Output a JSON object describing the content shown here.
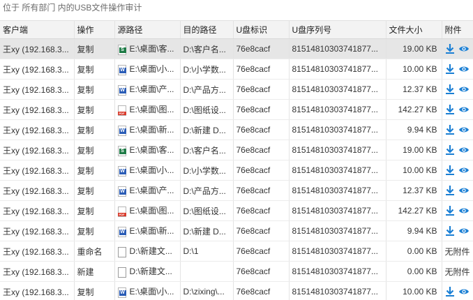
{
  "breadcrumb": "位于 所有部门 内的USB文件操作审计",
  "columns": [
    "客户端",
    "操作",
    "源路径",
    "目的路径",
    "U盘标识",
    "U盘序列号",
    "文件大小",
    "附件"
  ],
  "rows": [
    {
      "client": "王xy (192.168.3...",
      "op": "复制",
      "icon": "excel",
      "src": "E:\\桌面\\客...",
      "dst": "D:\\客户名...",
      "uid": "76e8cacf",
      "serial": "81514810303741877...",
      "size": "19.00 KB",
      "attach": "icons",
      "selected": true
    },
    {
      "client": "王xy (192.168.3...",
      "op": "复制",
      "icon": "word",
      "src": "E:\\桌面\\小...",
      "dst": "D:\\小学数...",
      "uid": "76e8cacf",
      "serial": "81514810303741877...",
      "size": "10.00 KB",
      "attach": "icons"
    },
    {
      "client": "王xy (192.168.3...",
      "op": "复制",
      "icon": "word",
      "src": "E:\\桌面\\产...",
      "dst": "D:\\产品方...",
      "uid": "76e8cacf",
      "serial": "81514810303741877...",
      "size": "12.37 KB",
      "attach": "icons"
    },
    {
      "client": "王xy (192.168.3...",
      "op": "复制",
      "icon": "pdf",
      "src": "E:\\桌面\\图...",
      "dst": "D:\\图纸设...",
      "uid": "76e8cacf",
      "serial": "81514810303741877...",
      "size": "142.27 KB",
      "attach": "icons"
    },
    {
      "client": "王xy (192.168.3...",
      "op": "复制",
      "icon": "word",
      "src": "E:\\桌面\\新...",
      "dst": "D:\\新建 D...",
      "uid": "76e8cacf",
      "serial": "81514810303741877...",
      "size": "9.94 KB",
      "attach": "icons"
    },
    {
      "client": "王xy (192.168.3...",
      "op": "复制",
      "icon": "excel",
      "src": "E:\\桌面\\客...",
      "dst": "D:\\客户名...",
      "uid": "76e8cacf",
      "serial": "81514810303741877...",
      "size": "19.00 KB",
      "attach": "icons"
    },
    {
      "client": "王xy (192.168.3...",
      "op": "复制",
      "icon": "word",
      "src": "E:\\桌面\\小...",
      "dst": "D:\\小学数...",
      "uid": "76e8cacf",
      "serial": "81514810303741877...",
      "size": "10.00 KB",
      "attach": "icons"
    },
    {
      "client": "王xy (192.168.3...",
      "op": "复制",
      "icon": "word",
      "src": "E:\\桌面\\产...",
      "dst": "D:\\产品方...",
      "uid": "76e8cacf",
      "serial": "81514810303741877...",
      "size": "12.37 KB",
      "attach": "icons"
    },
    {
      "client": "王xy (192.168.3...",
      "op": "复制",
      "icon": "pdf",
      "src": "E:\\桌面\\图...",
      "dst": "D:\\图纸设...",
      "uid": "76e8cacf",
      "serial": "81514810303741877...",
      "size": "142.27 KB",
      "attach": "icons"
    },
    {
      "client": "王xy (192.168.3...",
      "op": "复制",
      "icon": "word",
      "src": "E:\\桌面\\新...",
      "dst": "D:\\新建 D...",
      "uid": "76e8cacf",
      "serial": "81514810303741877...",
      "size": "9.94 KB",
      "attach": "icons"
    },
    {
      "client": "王xy (192.168.3...",
      "op": "重命名",
      "icon": "blank",
      "src": "D:\\新建文...",
      "dst": "D:\\1",
      "uid": "76e8cacf",
      "serial": "81514810303741877...",
      "size": "0.00 KB",
      "attach": "无附件"
    },
    {
      "client": "王xy (192.168.3...",
      "op": "新建",
      "icon": "blank",
      "src": "D:\\新建文...",
      "dst": "",
      "uid": "76e8cacf",
      "serial": "81514810303741877...",
      "size": "0.00 KB",
      "attach": "无附件"
    },
    {
      "client": "王xy (192.168.3...",
      "op": "复制",
      "icon": "word",
      "src": "E:\\桌面\\小...",
      "dst": "D:\\zixing\\...",
      "uid": "76e8cacf",
      "serial": "81514810303741877...",
      "size": "10.00 KB",
      "attach": "icons"
    }
  ],
  "colors": {
    "accent": "#1a7fd4",
    "selected_row": "#e6e6e6"
  },
  "icon_names": {
    "download": "download-icon",
    "view": "eye-icon"
  }
}
